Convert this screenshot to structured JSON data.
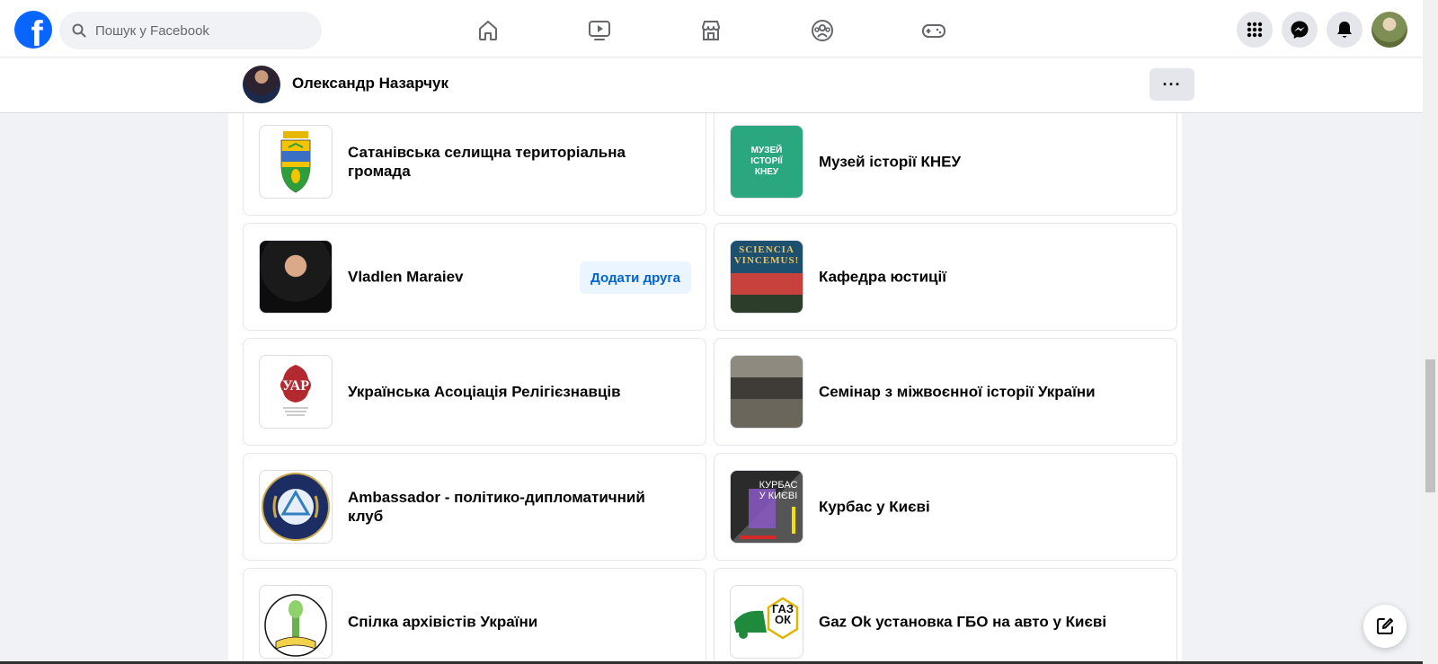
{
  "topbar": {
    "logo_text": "f",
    "search_placeholder": "Пошук у Facebook",
    "nav": [
      "home-icon",
      "watch-icon",
      "marketplace-icon",
      "groups-icon",
      "gaming-icon"
    ],
    "right": [
      "menu-icon",
      "messenger-icon",
      "notifications-icon",
      "account-avatar"
    ]
  },
  "profile": {
    "name": "Олександр Назарчук",
    "more_label": "···"
  },
  "cards": [
    {
      "title": "Сатанівська селищна територіальна громада"
    },
    {
      "title": "Музей історії КНЕУ",
      "thumb_text": "МУЗЕЙ ІСТОРІЇ КНЕУ"
    },
    {
      "title": "Vladlen Maraiev",
      "action": "Додати друга"
    },
    {
      "title": "Кафедра юстиції",
      "thumb_text": "SCIENCIA VINCEMUS!"
    },
    {
      "title": "Українська Асоціація Релігієзнавців"
    },
    {
      "title": "Семінар з міжвоєнної історії України"
    },
    {
      "title": "Ambassador - політико-дипломатичний клуб"
    },
    {
      "title": "Курбас у Києві",
      "thumb_text": "КУРБАС У КИЄВІ"
    },
    {
      "title": "Спілка архівістів України"
    },
    {
      "title": "Gaz Ok установка ГБО на авто у Києві",
      "thumb_text": "ГАЗ ОК"
    }
  ],
  "colors": {
    "brand": "#0866ff",
    "page_bg": "#f0f2f5",
    "add_friend_bg": "#ebf5ff",
    "add_friend_text": "#0064d1"
  }
}
